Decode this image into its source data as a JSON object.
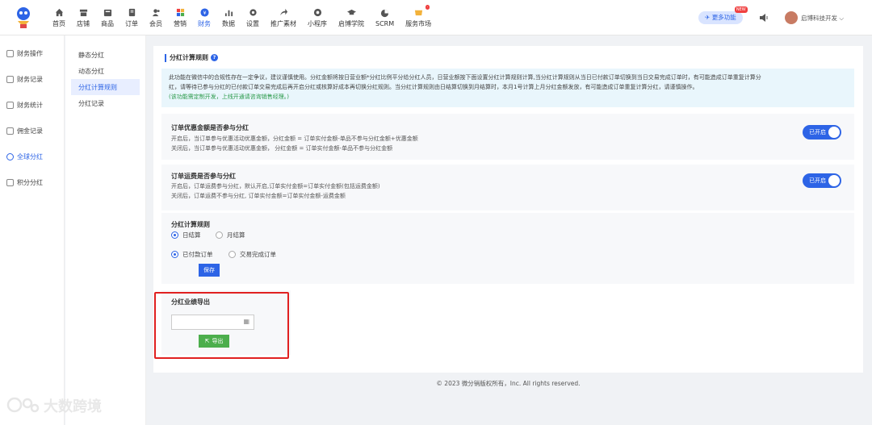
{
  "nav": [
    {
      "label": "首页",
      "icon": "home-icon"
    },
    {
      "label": "店铺",
      "icon": "store-icon"
    },
    {
      "label": "商品",
      "icon": "goods-icon"
    },
    {
      "label": "订单",
      "icon": "order-icon"
    },
    {
      "label": "会员",
      "icon": "member-icon"
    },
    {
      "label": "营销",
      "icon": "marketing-icon"
    },
    {
      "label": "财务",
      "icon": "finance-icon"
    },
    {
      "label": "数据",
      "icon": "chart-icon"
    },
    {
      "label": "设置",
      "icon": "gear-icon"
    },
    {
      "label": "推广素材",
      "icon": "share-icon"
    },
    {
      "label": "小程序",
      "icon": "miniprogram-icon"
    },
    {
      "label": "启博学院",
      "icon": "academy-icon"
    },
    {
      "label": "SCRM",
      "icon": "scrm-icon"
    },
    {
      "label": "服务市场",
      "icon": "market-icon"
    }
  ],
  "header": {
    "more_features": "更多功能",
    "new_badge": "NEW",
    "user_name": "启博科技开发"
  },
  "sidebar1": [
    {
      "label": "财务操作"
    },
    {
      "label": "财务记录"
    },
    {
      "label": "财务统计"
    },
    {
      "label": "佣金记录"
    },
    {
      "label": "全球分红"
    },
    {
      "label": "积分分红"
    }
  ],
  "sidebar2": [
    {
      "label": "静态分红"
    },
    {
      "label": "动态分红"
    },
    {
      "label": "分红计算规则"
    },
    {
      "label": "分红记录"
    }
  ],
  "main": {
    "title": "分红计算规则",
    "notice_line1": "此功能在微信中的合规性存在一定争议，建议谨慎使用。分红金额将按日营业额*分红比例平分给分红人员，日营业额按下面设置分红计算规则计算,当分红计算规则从当日已付款订单切换到当日交易完成订单时，有可能造成订单重复计算分",
    "notice_line2": "红，请等待已参与分红的已付款订单交易完成后再开启分红或核算好成本再切换分红规则。当分红计算规则由日结算切换到月结算时，本月1号计算上月分红金额发放，有可能造成订单重复计算分红，请谨慎操作。",
    "notice_line3": "(该功能需定制开发，上线开通请咨询销售经理。)",
    "discount": {
      "title": "订单优惠金额是否参与分红",
      "line1": "开启后，当订单参与优惠活动优惠金额，分红金额 = 订单实付金额-单品不参与分红金额+优惠金额",
      "line2": "关闭后，当订单参与优惠活动优惠金额， 分红金额 = 订单实付金额-单品不参与分红金额",
      "toggle": "已开启"
    },
    "shipping": {
      "title": "订单运费是否参与分红",
      "line1": "开启后，订单运费参与分红，默认开启,订单实付金额=订单实付金额(包括运费金额)",
      "line2": "关闭后，订单运费不参与分红, 订单实付金额=订单实付金额-运费金额",
      "toggle": "已开启"
    },
    "rule": {
      "title": "分红计算规则",
      "opt_daily": "日结算",
      "opt_monthly": "月结算",
      "opt_paid": "已付款订单",
      "opt_completed": "交易完成订单",
      "save": "保存"
    },
    "export": {
      "title": "分红业绩导出",
      "button": "导出"
    }
  },
  "footer": "© 2023 微分销版权所有，Inc. All rights reserved.",
  "watermark": "大数跨境"
}
